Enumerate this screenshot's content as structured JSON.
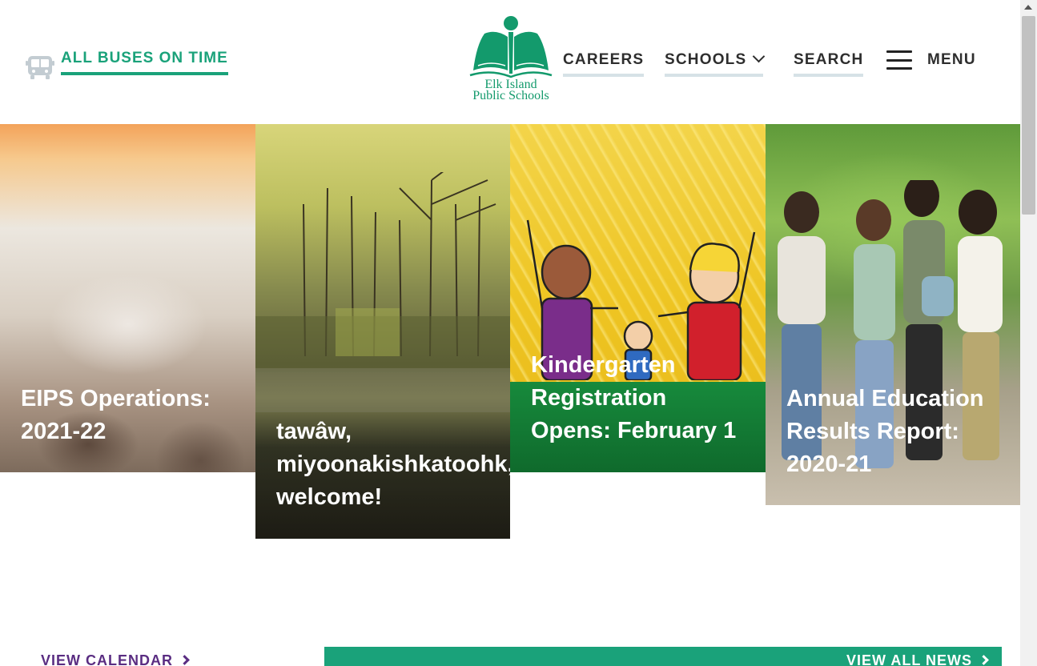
{
  "header": {
    "bus_status": "ALL BUSES ON TIME",
    "logo_line1": "Elk Island",
    "logo_line2": "Public Schools",
    "nav": {
      "careers": "CAREERS",
      "schools": "SCHOOLS",
      "search": "SEARCH",
      "menu": "MENU"
    }
  },
  "cards": [
    {
      "line1": "EIPS Operations:",
      "line2": "2021-22"
    },
    {
      "line1": "tawâw,",
      "line2": "miyoonakishkatoohk,",
      "line3": "welcome!"
    },
    {
      "line1": "Kindergarten",
      "line2": "Registration",
      "line3": "Opens: February 1"
    },
    {
      "line1": "Annual Education",
      "line2": "Results Report:",
      "line3": "2020-21"
    }
  ],
  "bottom": {
    "view_calendar": "VIEW CALENDAR",
    "view_all_news": "VIEW ALL NEWS"
  },
  "colors": {
    "brand_green": "#1aa27a",
    "purple": "#5a2d82",
    "nav_text": "#2e2e2e"
  }
}
